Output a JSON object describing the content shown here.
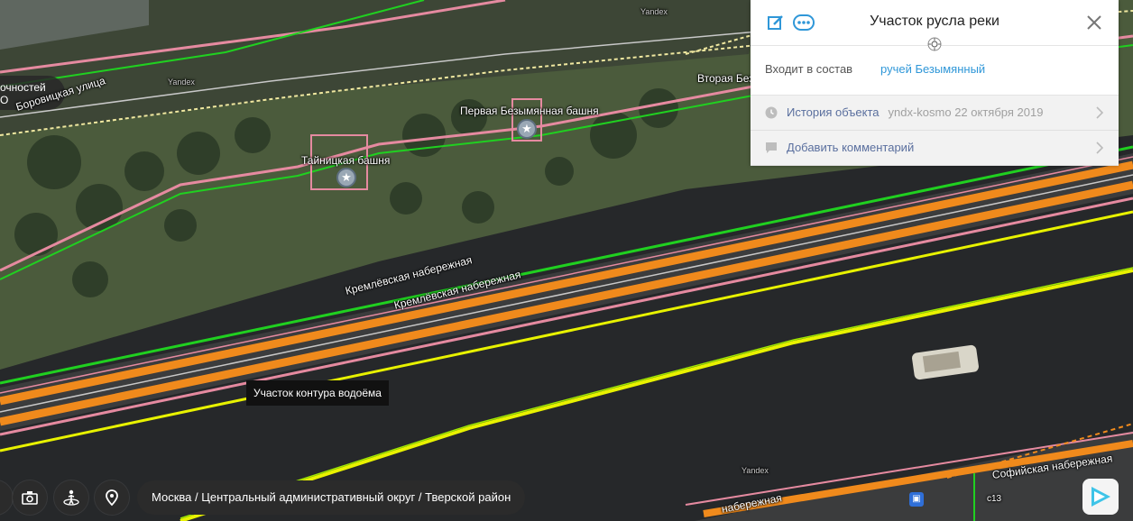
{
  "map": {
    "labels": {
      "left_cut_line1": "очностей",
      "left_cut_line2": "О",
      "borovitskaya": "Боровицкая улица",
      "yandex_wm1": "Yandex",
      "yandex_wm2": "Yandex",
      "yandex_wm3": "Yandex",
      "second_tower": "Вторая Безь",
      "first_tower": "Первая Безымянная башня",
      "taynitskaya": "Тайницкая башня",
      "kremlin_emb_1": "Кремлёвская набережная",
      "kremlin_emb_2": "Кремлёвская набережная",
      "sofia_emb_1": "Софийская набережная",
      "sofia_emb_2": "набережная",
      "building_code": "с13"
    },
    "tooltip": "Участок контура водоёма"
  },
  "panel": {
    "title": "Участок русла реки",
    "part_of_label": "Входит в состав",
    "part_of_link": "ручей Безымянный",
    "history_label": "История объекта",
    "history_meta": "yndx-kosmo 22 октября 2019",
    "comment_label": "Добавить комментарий",
    "icons": [
      "edit-icon",
      "more-icon",
      "close-icon",
      "crosshair-icon",
      "clock-icon",
      "comment-icon",
      "chevron-right-icon"
    ]
  },
  "bottom": {
    "breadcrumb": "Москва / Центральный административный округ / Тверской район",
    "icons": [
      "camera-icon",
      "panorama-icon",
      "pin-icon",
      "play-icon"
    ]
  },
  "colors": {
    "accent_blue": "#2f97d8",
    "road_orange": "#f08a1c",
    "water_yellow": "#e8f200",
    "border_green": "#20d020",
    "pink_outline": "#e58aa0"
  }
}
